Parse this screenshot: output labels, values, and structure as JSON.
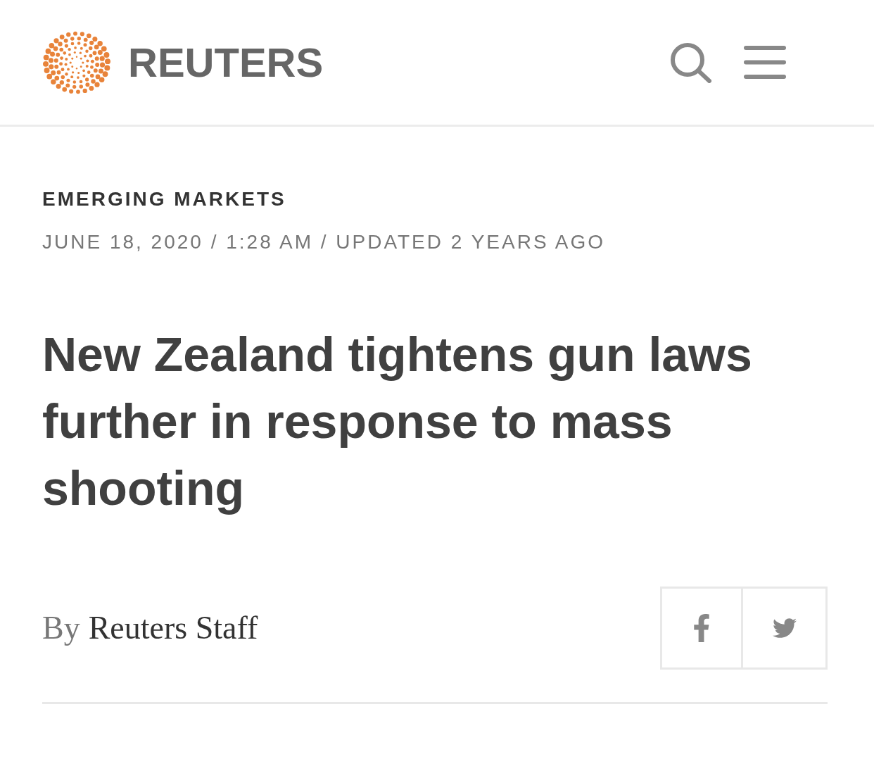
{
  "header": {
    "logo_text": "REUTERS"
  },
  "article": {
    "section": "EMERGING MARKETS",
    "dateline": "JUNE 18, 2020 / 1:28 AM / UPDATED 2 YEARS AGO",
    "headline": "New Zealand tightens gun laws further in response to mass shooting",
    "byline": {
      "prefix": "By",
      "author": "Reuters Staff"
    }
  }
}
